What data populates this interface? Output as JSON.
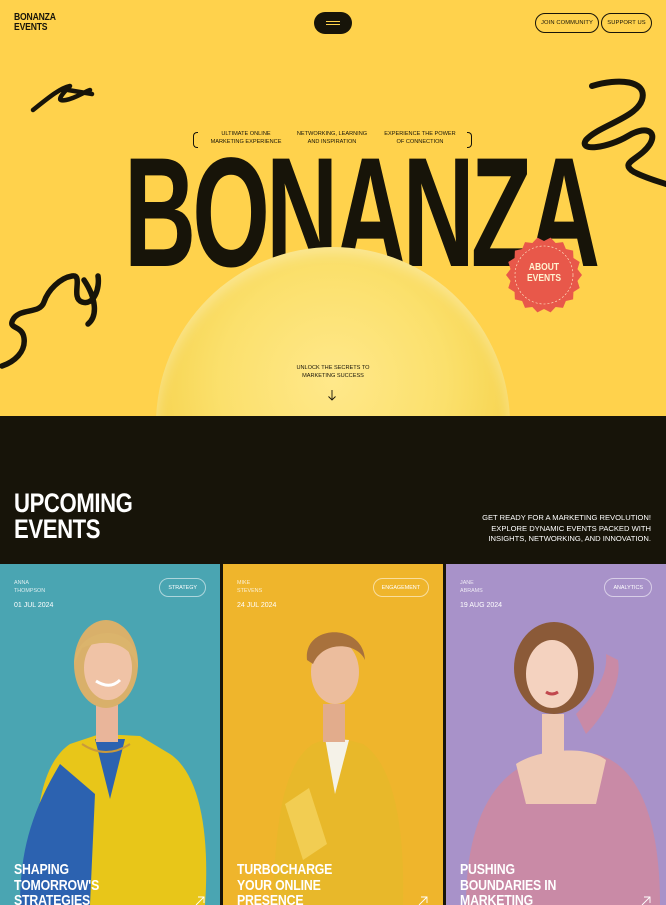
{
  "brand": {
    "logo_line1": "BONANZA",
    "logo_line2": "EVENTS"
  },
  "nav": {
    "join_label": "JOIN COMMUNITY",
    "support_label": "SUPPORT US",
    "menu_icon": "hamburger-icon"
  },
  "hero": {
    "taglines": [
      {
        "line1": "ULTIMATE ONLINE",
        "line2": "MARKETING EXPERIENCE"
      },
      {
        "line1": "NETWORKING, LEARNING",
        "line2": "AND INSPIRATION"
      },
      {
        "line1": "EXPERIENCE THE POWER",
        "line2": "OF CONNECTION"
      }
    ],
    "headline": "BONANZA",
    "badge_line1": "ABOUT",
    "badge_line2": "EVENTS",
    "unlock_line1": "UNLOCK THE SECRETS TO",
    "unlock_line2": "MARKETING SUCCESS",
    "scroll_icon": "arrow-down-icon"
  },
  "events": {
    "title_line1": "UPCOMING",
    "title_line2": "EVENTS",
    "subtitle_line1": "GET READY FOR A MARKETING REVOLUTION!",
    "subtitle_line2": "EXPLORE DYNAMIC EVENTS PACKED WITH",
    "subtitle_line3": "INSIGHTS, NETWORKING, AND INNOVATION.",
    "cards": [
      {
        "first": "ANNA",
        "last": "THOMPSON",
        "date": "01 JUL 2024",
        "tag": "STRATEGY",
        "title1": "SHAPING",
        "title2": "TOMORROW'S",
        "title3": "STRATEGIES",
        "bg": "#4aa5b2"
      },
      {
        "first": "MIKE",
        "last": "STEVENS",
        "date": "24 JUL 2024",
        "tag": "ENGAGEMENT",
        "title1": "TURBOCHARGE",
        "title2": "YOUR ONLINE",
        "title3": "PRESENCE",
        "bg": "#efb52c"
      },
      {
        "first": "JANE",
        "last": "ABRAMS",
        "date": "19 AUG 2024",
        "tag": "ANALYTICS",
        "title1": "PUSHING",
        "title2": "BOUNDARIES IN",
        "title3": "MARKETING",
        "bg": "#a892c9"
      }
    ]
  },
  "colors": {
    "yellow": "#ffd24c",
    "dark": "#171409",
    "badge": "#e8584a"
  }
}
